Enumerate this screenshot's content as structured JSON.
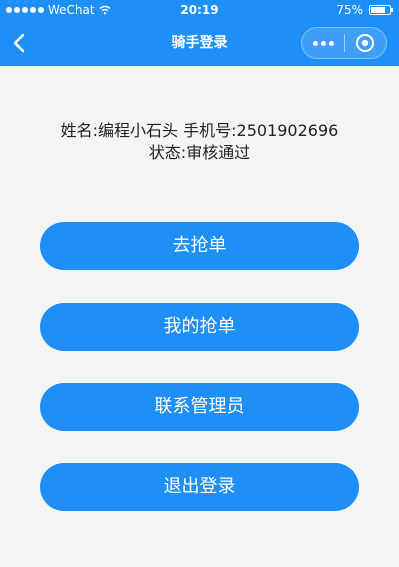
{
  "status_bar": {
    "carrier": "WeChat",
    "time": "20:19",
    "battery_text": "75%",
    "battery_level": 0.75
  },
  "nav": {
    "title": "骑手登录"
  },
  "info": {
    "line1": "姓名:编程小石头 手机号:2501902696",
    "line2": "状态:审核通过"
  },
  "buttons": [
    {
      "label": "去抢单"
    },
    {
      "label": "我的抢单"
    },
    {
      "label": "联系管理员"
    },
    {
      "label": "退出登录"
    }
  ],
  "colors": {
    "primary": "#1e8ff7",
    "background": "#f4f4f4"
  }
}
